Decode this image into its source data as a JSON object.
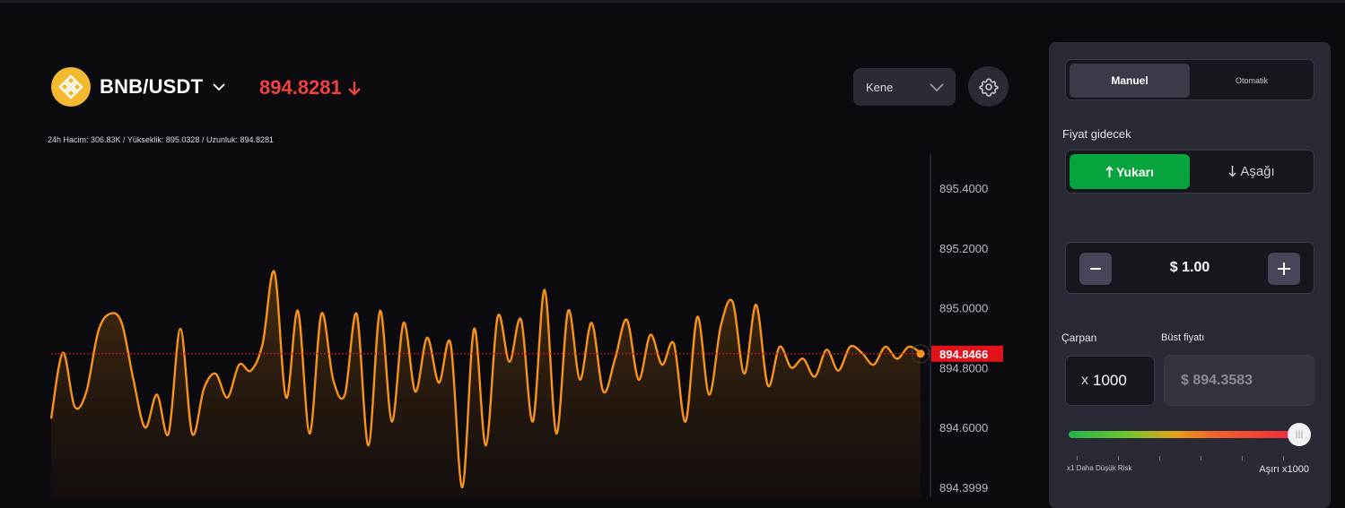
{
  "header": {
    "pair": "BNB/USDT",
    "price": "894.8281",
    "price_direction": "down",
    "price_color": "#f0433f",
    "coin_icon": "bnb-coin-icon",
    "interval_select": "Kene",
    "stats": "24h Hacim: 306.83K / Yükseklik: 895.0328 / Uzunluk: 894.8281"
  },
  "chart_data": {
    "type": "area",
    "ylim": [
      894.3999,
      895.4
    ],
    "yticks": [
      "895.4000",
      "895.2000",
      "895.0000",
      "894.8000",
      "894.6000",
      "894.3999"
    ],
    "current_price_label": "894.8466",
    "current_price": 894.8466,
    "line_color": "#f7931a",
    "marker_color": "#e2121b",
    "values": [
      894.63,
      894.85,
      894.67,
      894.72,
      894.92,
      894.98,
      894.95,
      894.76,
      894.6,
      894.71,
      894.58,
      894.93,
      894.58,
      894.73,
      894.78,
      894.7,
      894.81,
      894.79,
      894.88,
      895.12,
      894.7,
      894.99,
      894.58,
      894.98,
      894.76,
      894.71,
      894.98,
      894.54,
      894.99,
      894.62,
      894.95,
      894.72,
      894.9,
      894.75,
      894.88,
      894.4,
      894.93,
      894.54,
      894.97,
      894.82,
      894.96,
      894.62,
      895.06,
      894.58,
      894.99,
      894.76,
      894.95,
      894.72,
      894.83,
      894.96,
      894.76,
      894.91,
      894.81,
      894.88,
      894.62,
      894.97,
      894.71,
      894.94,
      895.02,
      894.78,
      895.01,
      894.74,
      894.87,
      894.8,
      894.83,
      894.77,
      894.86,
      894.79,
      894.87,
      894.85,
      894.81,
      894.87,
      894.83,
      894.87,
      894.85
    ]
  },
  "panel": {
    "modes": [
      "Manuel",
      "Otomatik"
    ],
    "active_mode": "Manuel",
    "direction_label": "Fiyat gidecek",
    "up_label": "Yukarı",
    "down_label": "Aşağı",
    "up_color": "#07a33d",
    "amount": "$ 1.00",
    "multiplier_label": "Çarpan",
    "multiplier_prefix": "x",
    "multiplier_value": "1000",
    "bust_label": "Büst fiyatı",
    "bust_value": "$ 894.3583",
    "slider_level": 1.0,
    "risk_low": "x1 Daha Düşük Risk",
    "risk_high": "Aşırı x1000"
  }
}
